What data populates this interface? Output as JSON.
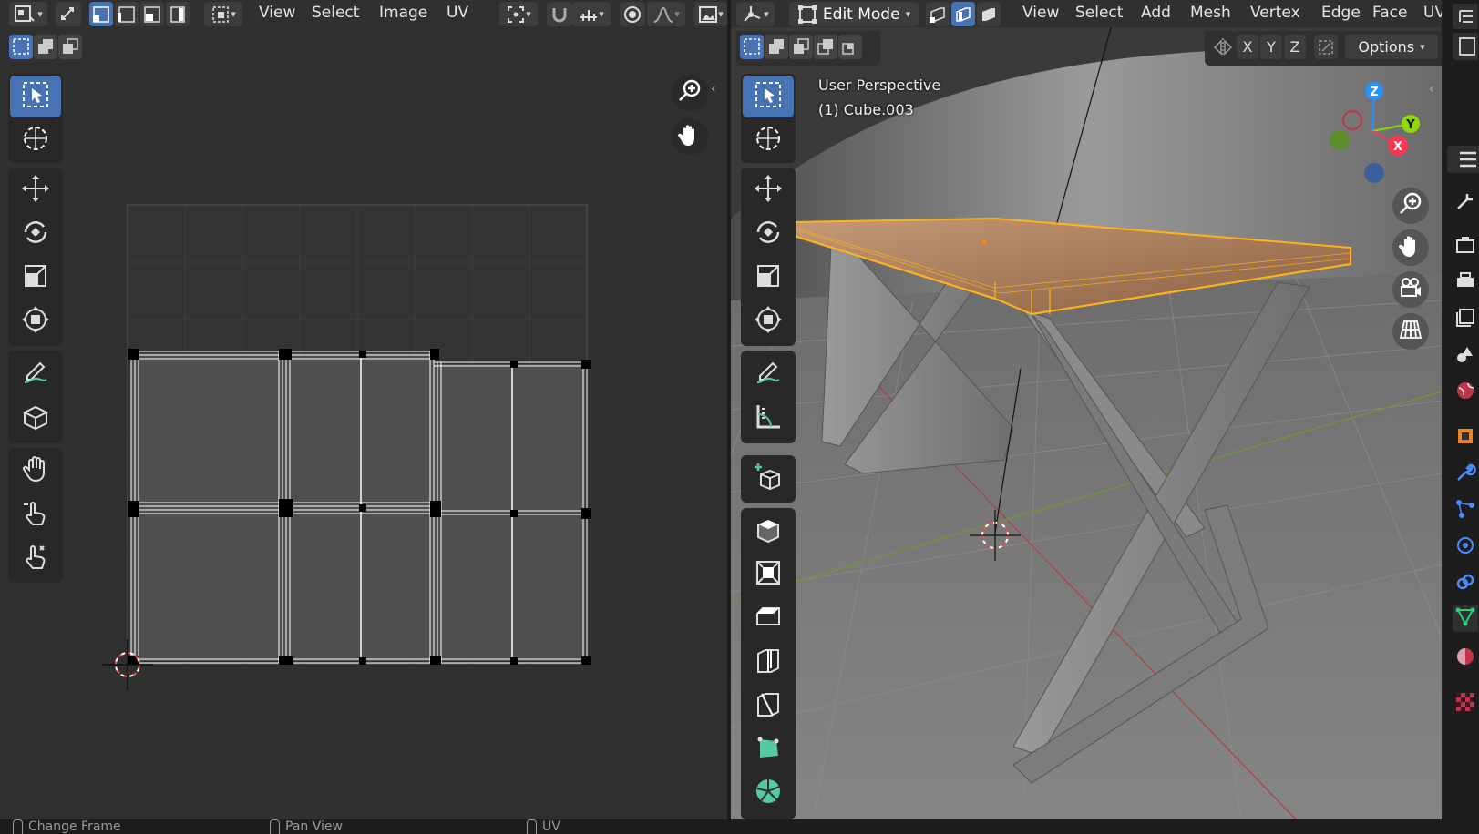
{
  "uv_editor": {
    "menu": [
      "View",
      "Select",
      "Image",
      "UV"
    ]
  },
  "viewport": {
    "mode": "Edit Mode",
    "menu": [
      "View",
      "Select",
      "Add",
      "Mesh",
      "Vertex",
      "Edge",
      "Face",
      "UV"
    ],
    "axes": {
      "x": "X",
      "y": "Y",
      "z": "Z"
    },
    "options_label": "Options",
    "overlay": {
      "perspective": "User Perspective",
      "object": "(1) Cube.003"
    },
    "gizmo": {
      "x": "X",
      "y": "Y",
      "z": "Z"
    }
  },
  "status_bar": {
    "items": [
      "Change Frame",
      "Pan View",
      "UV"
    ]
  },
  "colors": {
    "accent": "#4772b3",
    "selection": "#ffb21a",
    "axis_x": "#ff3352",
    "axis_y": "#8bdc00",
    "axis_z": "#2890ff"
  }
}
